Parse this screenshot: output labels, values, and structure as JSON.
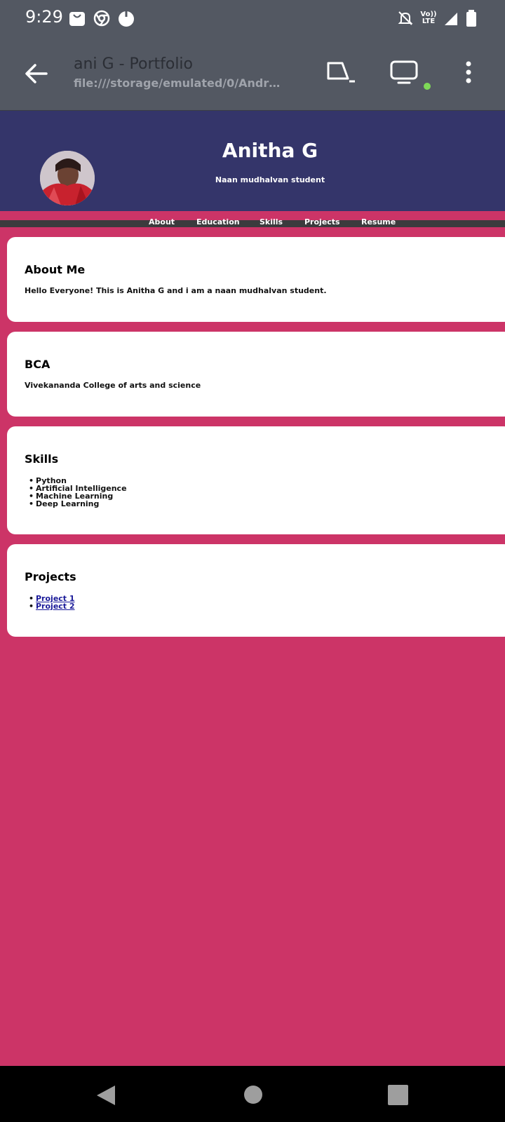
{
  "status_bar": {
    "time": "9:29",
    "left_icons": [
      "bag-icon",
      "chrome-icon",
      "app-icon"
    ],
    "right_icons": [
      "mute-icon",
      "volte-icon",
      "signal-icon",
      "battery-icon"
    ],
    "volte_label": "Vo)) LTE"
  },
  "toolbar": {
    "title": "ani G - Portfolio",
    "url": "file:///storage/emulated/0/Android/..."
  },
  "hero": {
    "name": "Anitha G",
    "subtitle": "Naan mudhalvan student"
  },
  "nav": {
    "items": [
      "About",
      "Education",
      "Skills",
      "Projects",
      "Resume"
    ]
  },
  "about": {
    "heading": "About Me",
    "text": "Hello Everyone! This is Anitha G and i am a naan mudhalvan student."
  },
  "education": {
    "heading": "BCA",
    "text": "Vivekananda College of arts and science"
  },
  "skills": {
    "heading": "Skills",
    "items": [
      "Python",
      "Artificial Intelligence",
      "Machine Learning",
      "Deep Learning"
    ]
  },
  "projects": {
    "heading": "Projects",
    "items": [
      "Project 1",
      "Project 2"
    ]
  },
  "colors": {
    "page_bg": "#cc3467",
    "hero_bg": "#34356a",
    "browser_chrome": "#535862",
    "nav_bar": "#3b3b3d",
    "online_dot": "#7ed957"
  }
}
